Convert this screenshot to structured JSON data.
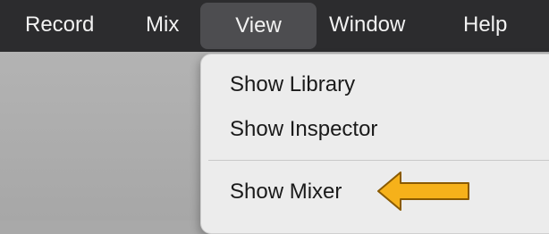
{
  "menubar": {
    "items": [
      {
        "label": "Record"
      },
      {
        "label": "Mix"
      },
      {
        "label": "View"
      },
      {
        "label": "Window"
      },
      {
        "label": "Help"
      }
    ],
    "active": "View"
  },
  "view_menu": {
    "items": [
      {
        "label": "Show Library"
      },
      {
        "label": "Show Inspector"
      },
      {
        "label": "Show Mixer"
      }
    ]
  },
  "annotation": {
    "arrow_color": "#F6B11A",
    "arrow_outline": "#8A5A00",
    "icon": "left-arrow-icon"
  }
}
